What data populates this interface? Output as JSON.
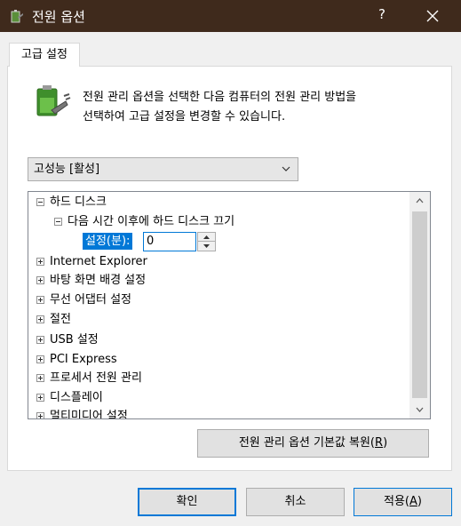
{
  "window": {
    "title": "전원 옵션",
    "help_label": "?",
    "title_bar_color": "#3f2a1c"
  },
  "tab": {
    "label": "고급 설정"
  },
  "header": {
    "icon": "battery-plug-icon",
    "description_line1": "전원 관리 옵션을 선택한 다음 컴퓨터의 전원 관리 방법을",
    "description_line2": "선택하여 고급 설정을 변경할 수 있습니다."
  },
  "plan_select": {
    "value": "고성능 [활성]"
  },
  "tree": {
    "items": [
      {
        "label": "하드 디스크",
        "toggle": "minus",
        "level": 0
      },
      {
        "label": "다음 시간 이후에 하드 디스크 끄기",
        "toggle": "minus",
        "level": 1
      },
      {
        "label": "Internet Explorer",
        "toggle": "plus",
        "level": 0
      },
      {
        "label": "바탕 화면 배경 설정",
        "toggle": "plus",
        "level": 0
      },
      {
        "label": "무선 어댑터 설정",
        "toggle": "plus",
        "level": 0
      },
      {
        "label": "절전",
        "toggle": "plus",
        "level": 0
      },
      {
        "label": "USB 설정",
        "toggle": "plus",
        "level": 0
      },
      {
        "label": "PCI Express",
        "toggle": "plus",
        "level": 0
      },
      {
        "label": "프로세서 전원 관리",
        "toggle": "plus",
        "level": 0
      },
      {
        "label": "디스플레이",
        "toggle": "plus",
        "level": 0
      },
      {
        "label": "멀티미디어 설정",
        "toggle": "plus",
        "level": 0
      }
    ],
    "setting": {
      "label": "설정(분):",
      "value": "0"
    }
  },
  "buttons": {
    "restore_prefix": "전원 관리 옵션 기본값 복원(",
    "restore_key": "R",
    "restore_suffix": ")",
    "ok": "확인",
    "cancel": "취소",
    "apply_prefix": "적용(",
    "apply_key": "A",
    "apply_suffix": ")"
  },
  "colors": {
    "accent": "#0078d7"
  }
}
